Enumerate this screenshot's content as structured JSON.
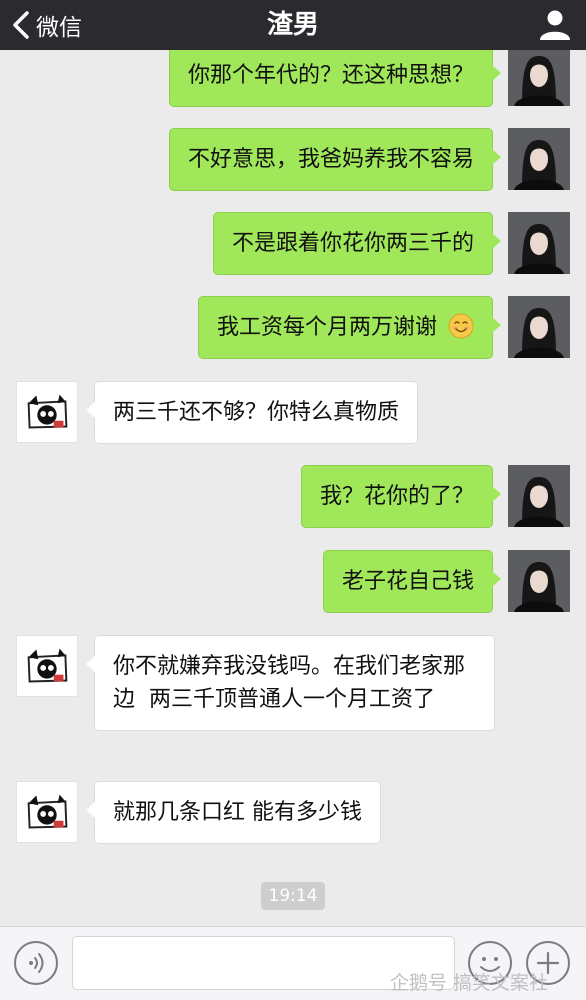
{
  "header": {
    "back_label": "微信",
    "title": "渣男",
    "back_icon": "chevron-left-icon",
    "profile_icon": "person-icon"
  },
  "messages": [
    {
      "side": "right",
      "text": "你那个年代的？还这种思想？"
    },
    {
      "side": "right",
      "text": "不好意思，我爸妈养我不容易"
    },
    {
      "side": "right",
      "text": "不是跟着你花你两三千的"
    },
    {
      "side": "right",
      "text": "我工资每个月两万谢谢",
      "emoji": "smiling-face-emoji"
    },
    {
      "side": "left",
      "text": "两三千还不够？你特么真物质"
    },
    {
      "side": "right",
      "text": "我？花你的了？"
    },
    {
      "side": "right",
      "text": "老子花自己钱"
    },
    {
      "side": "left",
      "text": "你不就嫌弃我没钱吗。在我们老家那边  两三千顶普通人一个月工资了"
    },
    {
      "side": "left",
      "text": "就那几条口红 能有多少钱"
    }
  ],
  "timestamp": "19:14",
  "input_bar": {
    "voice_icon": "voice-icon",
    "emoji_icon": "emoji-face-icon",
    "plus_icon": "plus-icon",
    "text_value": ""
  },
  "watermark": "企鹅号 搞笑文案社",
  "colors": {
    "topbar": "#2b2b2f",
    "sent_bubble": "#a0e75a",
    "received_bubble": "#ffffff",
    "background": "#ebebeb"
  }
}
